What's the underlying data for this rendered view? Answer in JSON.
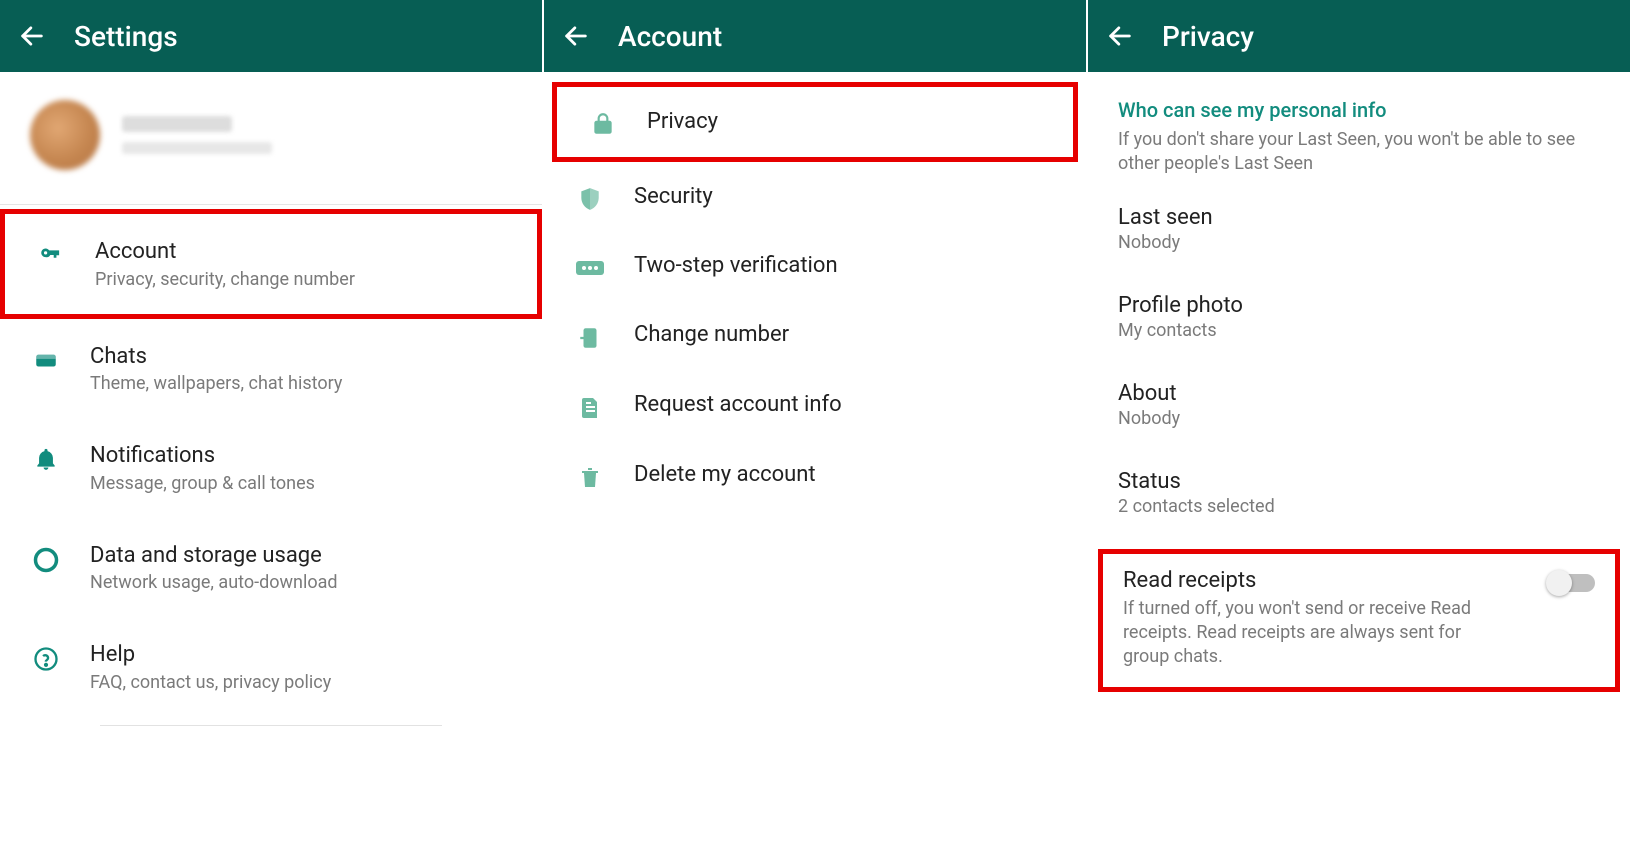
{
  "panels": {
    "settings": {
      "title": "Settings",
      "items": [
        {
          "label": "Account",
          "sub": "Privacy, security, change number"
        },
        {
          "label": "Chats",
          "sub": "Theme, wallpapers, chat history"
        },
        {
          "label": "Notifications",
          "sub": "Message, group & call tones"
        },
        {
          "label": "Data and storage usage",
          "sub": "Network usage, auto-download"
        },
        {
          "label": "Help",
          "sub": "FAQ, contact us, privacy policy"
        }
      ]
    },
    "account": {
      "title": "Account",
      "items": [
        {
          "label": "Privacy"
        },
        {
          "label": "Security"
        },
        {
          "label": "Two-step verification"
        },
        {
          "label": "Change number"
        },
        {
          "label": "Request account info"
        },
        {
          "label": "Delete my account"
        }
      ]
    },
    "privacy": {
      "title": "Privacy",
      "section_header": "Who can see my personal info",
      "section_sub": "If you don't share your Last Seen, you won't be able to see other people's Last Seen",
      "items": [
        {
          "label": "Last seen",
          "value": "Nobody"
        },
        {
          "label": "Profile photo",
          "value": "My contacts"
        },
        {
          "label": "About",
          "value": "Nobody"
        },
        {
          "label": "Status",
          "value": "2 contacts selected"
        }
      ],
      "read_receipts": {
        "label": "Read receipts",
        "desc": "If turned off, you won't send or receive Read receipts. Read receipts are always sent for group chats.",
        "enabled": false
      }
    }
  }
}
